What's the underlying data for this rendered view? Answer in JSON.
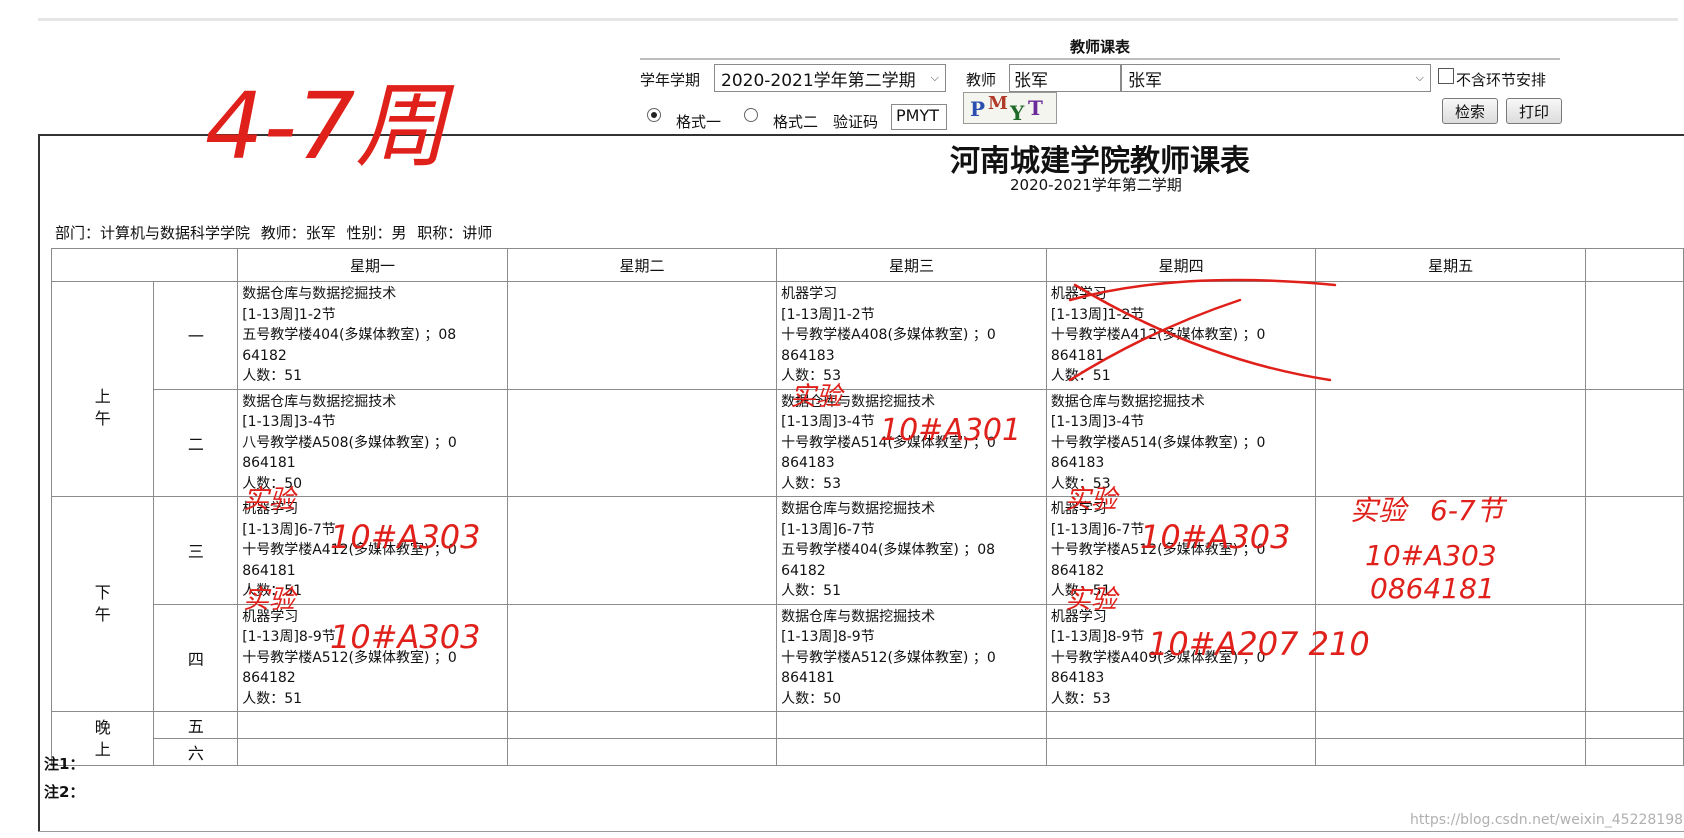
{
  "form": {
    "title": "教师课表",
    "term_label": "学年学期",
    "term_value": "2020-2021学年第二学期",
    "teacher_label": "教师",
    "teacher_code": "张军",
    "teacher_select": "张军",
    "exclude_label": "不含环节安排",
    "format1_label": "格式一",
    "format2_label": "格式二",
    "captcha_label": "验证码",
    "captcha_value": "PMYT",
    "captcha_image_text": "PMYT",
    "search_button": "检索",
    "print_button": "打印"
  },
  "report": {
    "title": "河南城建学院教师课表",
    "subtitle": "2020-2021学年第二学期",
    "meta": "部门：计算机与数据科学学院   教师：张军   性别：男   职称：讲师"
  },
  "schedule": {
    "days": [
      "星期一",
      "星期二",
      "星期三",
      "星期四",
      "星期五"
    ],
    "periods": {
      "morning": "上午",
      "afternoon": "下午",
      "evening": "晚上"
    },
    "slots": [
      "一",
      "二",
      "三",
      "四",
      "五",
      "六"
    ],
    "rows": [
      [
        [
          "数据仓库与数据挖掘技术",
          "[1-13周]1-2节",
          "五号教学楼404(多媒体教室) ；08",
          "64182",
          "人数：51"
        ],
        [],
        [
          "机器学习",
          "[1-13周]1-2节",
          "十号教学楼A408(多媒体教室) ；0",
          "864183",
          "人数：53"
        ],
        [
          "机器学习",
          "[1-13周]1-2节",
          "十号教学楼A412(多媒体教室) ；0",
          "864181",
          "人数：51"
        ],
        []
      ],
      [
        [
          "数据仓库与数据挖掘技术",
          "[1-13周]3-4节",
          "八号教学楼A508(多媒体教室) ；0",
          "864181",
          "人数：50"
        ],
        [],
        [
          "数据仓库与数据挖掘技术",
          "[1-13周]3-4节",
          "十号教学楼A514(多媒体教室) ；0",
          "864183",
          "人数：53"
        ],
        [
          "数据仓库与数据挖掘技术",
          "[1-13周]3-4节",
          "十号教学楼A514(多媒体教室) ；0",
          "864183",
          "人数：53"
        ],
        []
      ],
      [
        [
          "机器学习",
          "[1-13周]6-7节",
          "十号教学楼A412(多媒体教室) ；0",
          "864181",
          "人数：51"
        ],
        [],
        [
          "数据仓库与数据挖掘技术",
          "[1-13周]6-7节",
          "五号教学楼404(多媒体教室) ；08",
          "64182",
          "人数：51"
        ],
        [
          "机器学习",
          "[1-13周]6-7节",
          "十号教学楼A512(多媒体教室) ；0",
          "864182",
          "人数：51"
        ],
        []
      ],
      [
        [
          "机器学习",
          "[1-13周]8-9节",
          "十号教学楼A512(多媒体教室) ；0",
          "864182",
          "人数：51"
        ],
        [],
        [
          "数据仓库与数据挖掘技术",
          "[1-13周]8-9节",
          "十号教学楼A512(多媒体教室) ；0",
          "864181",
          "人数：50"
        ],
        [
          "机器学习",
          "[1-13周]8-9节",
          "十号教学楼A409(多媒体教室) ；0",
          "864183",
          "人数：53"
        ],
        []
      ]
    ]
  },
  "notes": [
    "注1：",
    "注2："
  ],
  "watermark": "https://blog.csdn.net/weixin_45228198",
  "annotations": {
    "weeks": "4-7周",
    "lab": "实验",
    "room_a301": "10#A301",
    "room_a303": "10#A303",
    "room_a303_fri": "10#A303",
    "code_fri": "0864181",
    "slot_fri": "6-7节",
    "room_a207": "10#A207 210",
    "ink_color": "#e0201a"
  }
}
